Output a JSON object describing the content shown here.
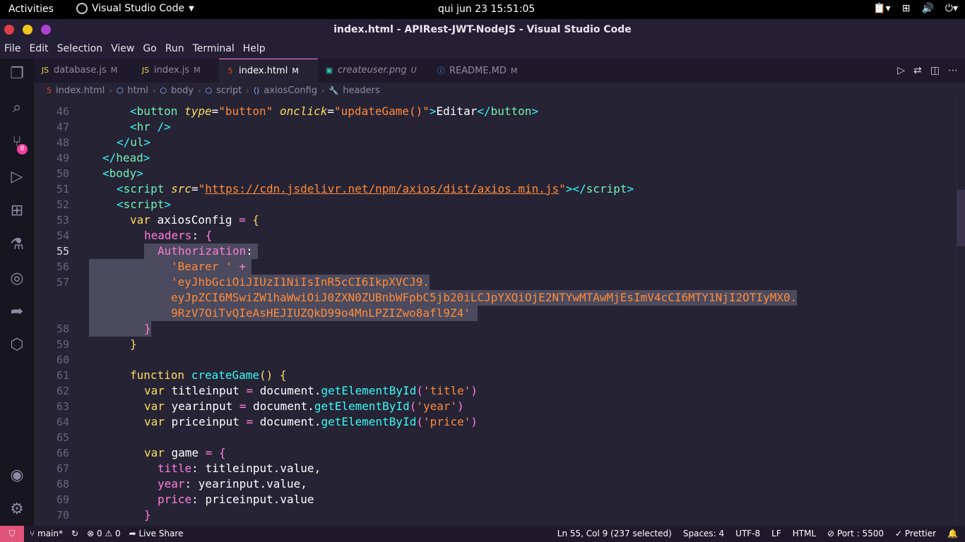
{
  "system": {
    "activities": "Activities",
    "app_name": "Visual Studio Code",
    "clock": "qui jun 23  15:51:05"
  },
  "window": {
    "title": "index.html - APIRest-JWT-NodeJS - Visual Studio Code",
    "colors": {
      "close": "#e0404a",
      "minimize": "#f0c420",
      "maximize": "#b040d0"
    }
  },
  "menu": [
    "File",
    "Edit",
    "Selection",
    "View",
    "Go",
    "Run",
    "Terminal",
    "Help"
  ],
  "activity_bar": {
    "icons": [
      "files-icon",
      "search-icon",
      "source-control-icon",
      "run-debug-icon",
      "extensions-icon",
      "testing-icon",
      "remote-explorer-icon",
      "live-share-icon",
      "docker-icon",
      "account-icon",
      "settings-gear-icon"
    ],
    "scm_badge": "8"
  },
  "tabs": [
    {
      "label": "database.js",
      "status": "M",
      "icon": "JS"
    },
    {
      "label": "index.js",
      "status": "M",
      "icon": "JS"
    },
    {
      "label": "index.html",
      "status": "M",
      "icon": "5",
      "active": true
    },
    {
      "label": "createuser.png",
      "status": "U",
      "icon": "img"
    },
    {
      "label": "README.MD",
      "status": "M",
      "icon": "i"
    }
  ],
  "breadcrumb": [
    "index.html",
    "html",
    "body",
    "script",
    "axiosConfig",
    "headers"
  ],
  "editor": {
    "line_numbers": [
      "46",
      "47",
      "48",
      "49",
      "50",
      "51",
      "52",
      "53",
      "54",
      "55",
      "56",
      "57",
      "58",
      "59",
      "60",
      "61",
      "62",
      "63",
      "64",
      "65",
      "66",
      "67",
      "68",
      "69",
      "70"
    ],
    "current_line": "55",
    "token_line1": "'eyJhbGciOiJIUzI1NiIsInR5cCI6IkpXVCJ9.",
    "token_line2": "eyJpZCI6MSwiZW1haWwiOiJ0ZXN0ZUBnbWFpbC5jb20iLCJpYXQiOjE2NTYwMTAwMjEsImV4cCI6MTY1NjI2OTIyMX0.",
    "token_line3": "9RzV7OiTvQIeAsHEJIUZQkD99o4MnLPZIZwo8afl9Z4'"
  },
  "status": {
    "branch": "main*",
    "errors": "0",
    "warnings": "0",
    "live_share": "Live Share",
    "cursor": "Ln 55, Col 9 (237 selected)",
    "spaces": "Spaces: 4",
    "encoding": "UTF-8",
    "eol": "LF",
    "language": "HTML",
    "port": "Port : 5500",
    "prettier": "Prettier"
  }
}
